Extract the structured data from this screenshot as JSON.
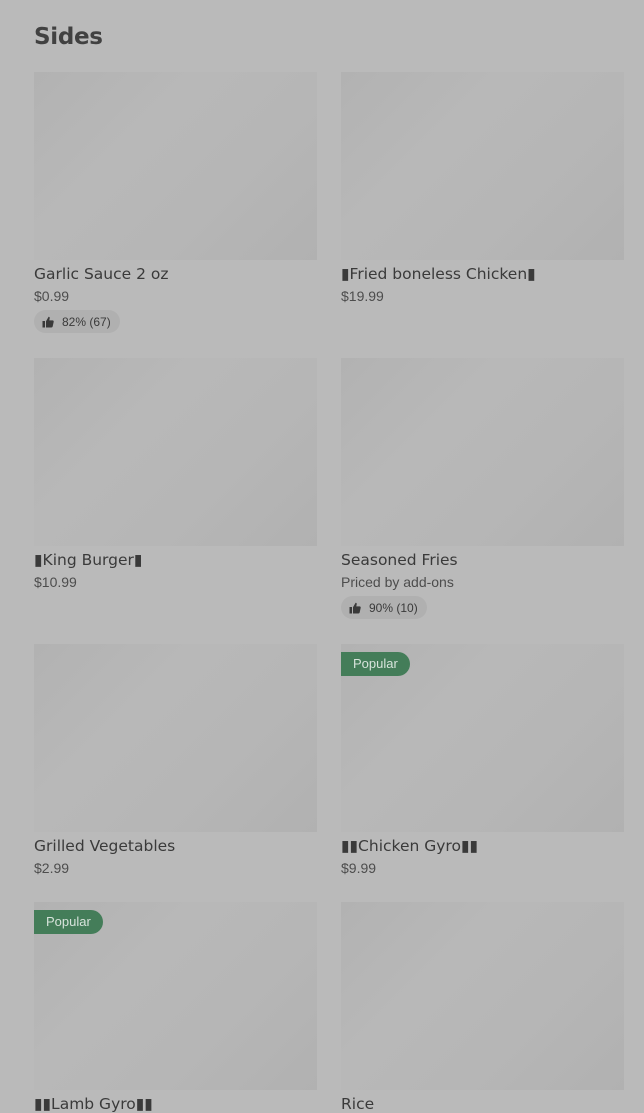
{
  "section": {
    "title": "Sides"
  },
  "items": [
    {
      "name": "Garlic Sauce 2 oz",
      "price": "$0.99",
      "rating": "82% (67)",
      "badge": ""
    },
    {
      "name": "▮Fried boneless Chicken▮",
      "price": "$19.99",
      "rating": "",
      "badge": ""
    },
    {
      "name": "▮King Burger▮",
      "price": "$10.99",
      "rating": "",
      "badge": ""
    },
    {
      "name": "Seasoned Fries",
      "price": "Priced by add-ons",
      "rating": "90% (10)",
      "badge": ""
    },
    {
      "name": "Grilled Vegetables",
      "price": "$2.99",
      "rating": "",
      "badge": ""
    },
    {
      "name": "▮▮Chicken Gyro▮▮",
      "price": "$9.99",
      "rating": "",
      "badge": "Popular"
    },
    {
      "name": "▮▮Lamb Gyro▮▮",
      "price": "",
      "rating": "",
      "badge": "Popular"
    },
    {
      "name": "Rice",
      "price": "",
      "rating": "",
      "badge": ""
    }
  ],
  "icons": {
    "rating": "thumbs-up-icon"
  },
  "colors": {
    "background": "#bababa",
    "badge": "#447d59",
    "rating_pill": "#b0b0b0"
  }
}
